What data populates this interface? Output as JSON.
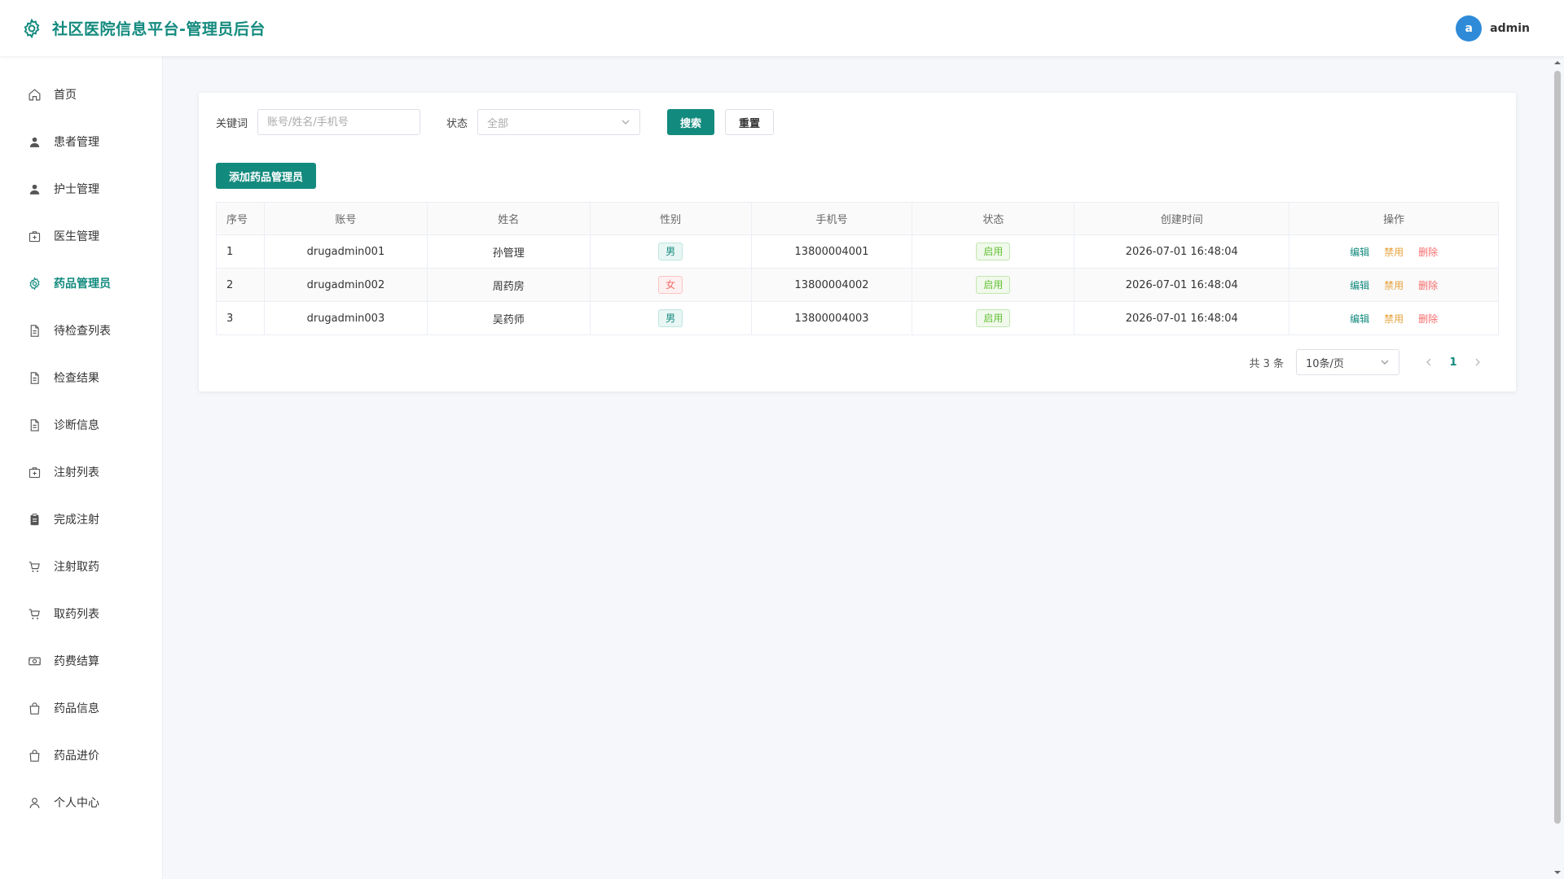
{
  "header": {
    "title": "社区医院信息平台-管理员后台",
    "avatar_letter": "a",
    "username": "admin",
    "brand_color": "#138a7e"
  },
  "sidebar": {
    "items": [
      {
        "label": "首页",
        "icon": "home-icon",
        "active": false
      },
      {
        "label": "患者管理",
        "icon": "user-icon",
        "active": false
      },
      {
        "label": "护士管理",
        "icon": "user-icon",
        "active": false
      },
      {
        "label": "医生管理",
        "icon": "medical-kit-icon",
        "active": false
      },
      {
        "label": "药品管理员",
        "icon": "gear-icon",
        "active": true
      },
      {
        "label": "待检查列表",
        "icon": "document-icon",
        "active": false
      },
      {
        "label": "检查结果",
        "icon": "document-icon",
        "active": false
      },
      {
        "label": "诊断信息",
        "icon": "document-icon",
        "active": false
      },
      {
        "label": "注射列表",
        "icon": "medical-kit-icon",
        "active": false
      },
      {
        "label": "完成注射",
        "icon": "clipboard-icon",
        "active": false
      },
      {
        "label": "注射取药",
        "icon": "cart-icon",
        "active": false
      },
      {
        "label": "取药列表",
        "icon": "cart-icon",
        "active": false
      },
      {
        "label": "药费结算",
        "icon": "money-icon",
        "active": false
      },
      {
        "label": "药品信息",
        "icon": "bag-icon",
        "active": false
      },
      {
        "label": "药品进价",
        "icon": "bag-icon",
        "active": false
      },
      {
        "label": "个人中心",
        "icon": "person-icon",
        "active": false
      }
    ]
  },
  "filters": {
    "keyword_label": "关键词",
    "keyword_placeholder": "账号/姓名/手机号",
    "keyword_value": "",
    "status_label": "状态",
    "status_value": "全部",
    "search_label": "搜索",
    "reset_label": "重置"
  },
  "add_button_label": "添加药品管理员",
  "table": {
    "columns": [
      "序号",
      "账号",
      "姓名",
      "性别",
      "手机号",
      "状态",
      "创建时间",
      "操作"
    ],
    "rows": [
      {
        "index": "1",
        "account": "drugadmin001",
        "name": "孙管理",
        "gender": "男",
        "phone": "13800004001",
        "status": "启用",
        "created": "2026-07-01 16:48:04"
      },
      {
        "index": "2",
        "account": "drugadmin002",
        "name": "周药房",
        "gender": "女",
        "phone": "13800004002",
        "status": "启用",
        "created": "2026-07-01 16:48:04"
      },
      {
        "index": "3",
        "account": "drugadmin003",
        "name": "吴药师",
        "gender": "男",
        "phone": "13800004003",
        "status": "启用",
        "created": "2026-07-01 16:48:04"
      }
    ],
    "actions": {
      "edit": "编辑",
      "disable": "禁用",
      "delete": "删除"
    }
  },
  "pagination": {
    "total_text": "共 3 条",
    "page_size": "10条/页",
    "current_page": "1"
  }
}
